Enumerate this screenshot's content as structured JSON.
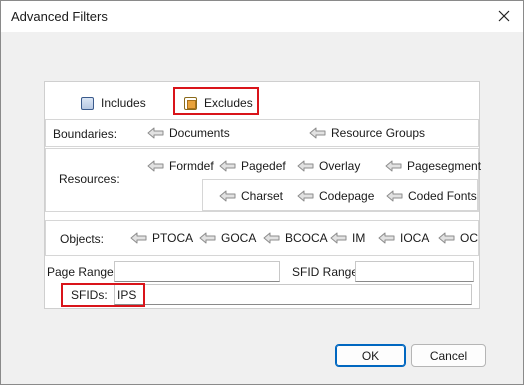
{
  "window": {
    "title": "Advanced Filters"
  },
  "mode": {
    "includes_label": "Includes",
    "excludes_label": "Excludes",
    "selected": "Excludes"
  },
  "boundaries": {
    "label": "Boundaries:",
    "items": [
      "Documents",
      "Resource Groups"
    ]
  },
  "resources": {
    "label": "Resources:",
    "row1": [
      "Formdef",
      "Pagedef",
      "Overlay",
      "Pagesegment"
    ],
    "row2": [
      "Charset",
      "Codepage",
      "Coded Fonts"
    ]
  },
  "objects": {
    "label": "Objects:",
    "items": [
      "PTOCA",
      "GOCA",
      "BCOCA",
      "IM",
      "IOCA",
      "OC"
    ]
  },
  "page_range": {
    "label": "Page Range:",
    "value": ""
  },
  "sfid_range": {
    "label": "SFID Range:",
    "value": ""
  },
  "sfids": {
    "label": "SFIDs:",
    "value": "IPS"
  },
  "buttons": {
    "ok": "OK",
    "cancel": "Cancel"
  },
  "colors": {
    "highlight": "#d9141a",
    "accent": "#0067c0"
  },
  "icons": {
    "item_arrow": "left-arrow-icon",
    "close": "close-icon"
  }
}
